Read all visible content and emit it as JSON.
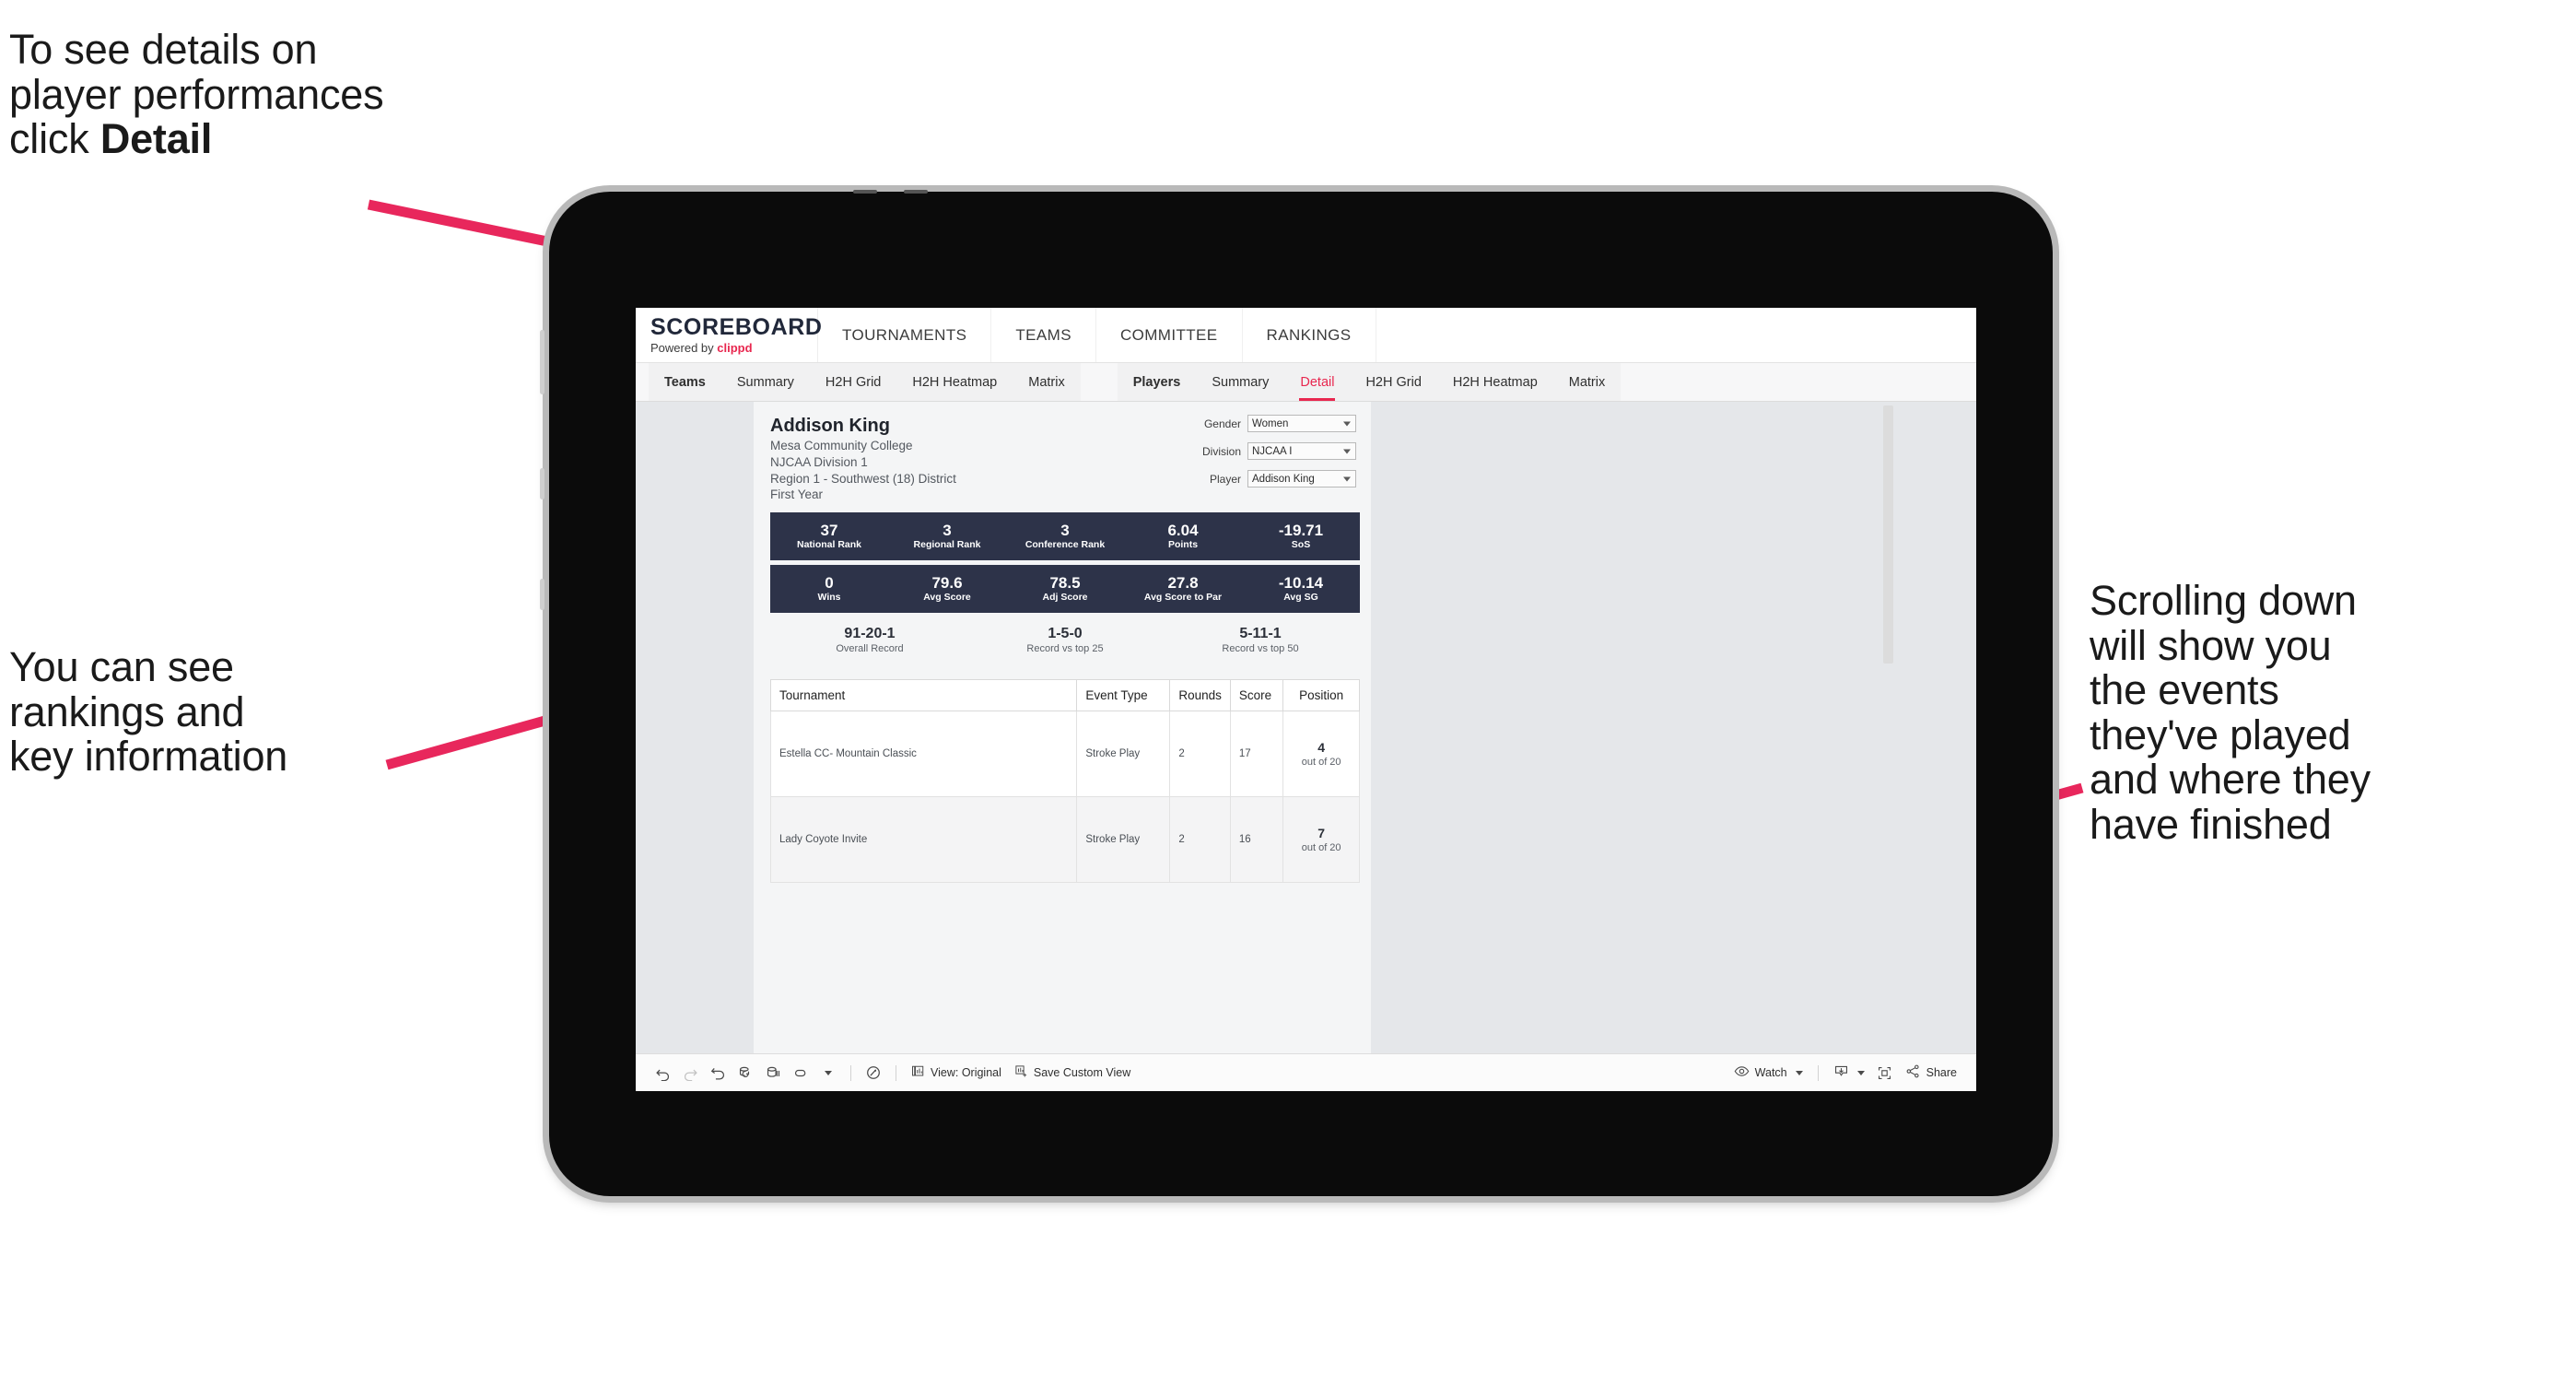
{
  "annotations": {
    "top_left": "To see details on\nplayer performances\nclick ",
    "top_left_bold": "Detail",
    "mid_left": "You can see\nrankings and\nkey information",
    "right": "Scrolling down\nwill show you\nthe events\nthey've played\nand where they\nhave finished"
  },
  "colors": {
    "accent_pink": "#e8274f",
    "band_navy": "#2d3349",
    "canvas_gray": "#e5e7ea"
  },
  "brand": {
    "title": "SCOREBOARD",
    "powered_prefix": "Powered by ",
    "powered_name": "clippd"
  },
  "top_nav": [
    {
      "label": "TOURNAMENTS"
    },
    {
      "label": "TEAMS"
    },
    {
      "label": "COMMITTEE"
    },
    {
      "label": "RANKINGS"
    }
  ],
  "sub_nav": {
    "teams_group": [
      {
        "label": "Teams",
        "head": true,
        "active": false
      },
      {
        "label": "Summary",
        "head": false,
        "active": false
      },
      {
        "label": "H2H Grid",
        "head": false,
        "active": false
      },
      {
        "label": "H2H Heatmap",
        "head": false,
        "active": false
      },
      {
        "label": "Matrix",
        "head": false,
        "active": false
      }
    ],
    "players_group": [
      {
        "label": "Players",
        "head": true,
        "active": false
      },
      {
        "label": "Summary",
        "head": false,
        "active": false
      },
      {
        "label": "Detail",
        "head": false,
        "active": true
      },
      {
        "label": "H2H Grid",
        "head": false,
        "active": false
      },
      {
        "label": "H2H Heatmap",
        "head": false,
        "active": false
      },
      {
        "label": "Matrix",
        "head": false,
        "active": false
      }
    ]
  },
  "player": {
    "name": "Addison King",
    "school": "Mesa Community College",
    "division": "NJCAA Division 1",
    "region": "Region 1 - Southwest (18) District",
    "year": "First Year"
  },
  "filters": [
    {
      "label": "Gender",
      "value": "Women"
    },
    {
      "label": "Division",
      "value": "NJCAA I"
    },
    {
      "label": "Player",
      "value": "Addison King"
    }
  ],
  "stats_row1": [
    {
      "value": "37",
      "label": "National Rank"
    },
    {
      "value": "3",
      "label": "Regional Rank"
    },
    {
      "value": "3",
      "label": "Conference Rank"
    },
    {
      "value": "6.04",
      "label": "Points"
    },
    {
      "value": "-19.71",
      "label": "SoS"
    }
  ],
  "stats_row2": [
    {
      "value": "0",
      "label": "Wins"
    },
    {
      "value": "79.6",
      "label": "Avg Score"
    },
    {
      "value": "78.5",
      "label": "Adj Score"
    },
    {
      "value": "27.8",
      "label": "Avg Score to Par"
    },
    {
      "value": "-10.14",
      "label": "Avg SG"
    }
  ],
  "records": [
    {
      "value": "91-20-1",
      "label": "Overall Record"
    },
    {
      "value": "1-5-0",
      "label": "Record vs top 25"
    },
    {
      "value": "5-11-1",
      "label": "Record vs top 50"
    }
  ],
  "table": {
    "columns": [
      "Tournament",
      "Event Type",
      "Rounds",
      "Score",
      "Position"
    ],
    "rows": [
      {
        "tournament": "Estella CC- Mountain Classic",
        "event_type": "Stroke Play",
        "rounds": "2",
        "score": "17",
        "position_value": "4",
        "position_label": "out of 20"
      },
      {
        "tournament": "Lady Coyote Invite",
        "event_type": "Stroke Play",
        "rounds": "2",
        "score": "16",
        "position_value": "7",
        "position_label": "out of 20"
      }
    ]
  },
  "toolbar": {
    "view_label": "View: Original",
    "save_custom_view_label": "Save Custom View",
    "watch_label": "Watch",
    "share_label": "Share"
  }
}
